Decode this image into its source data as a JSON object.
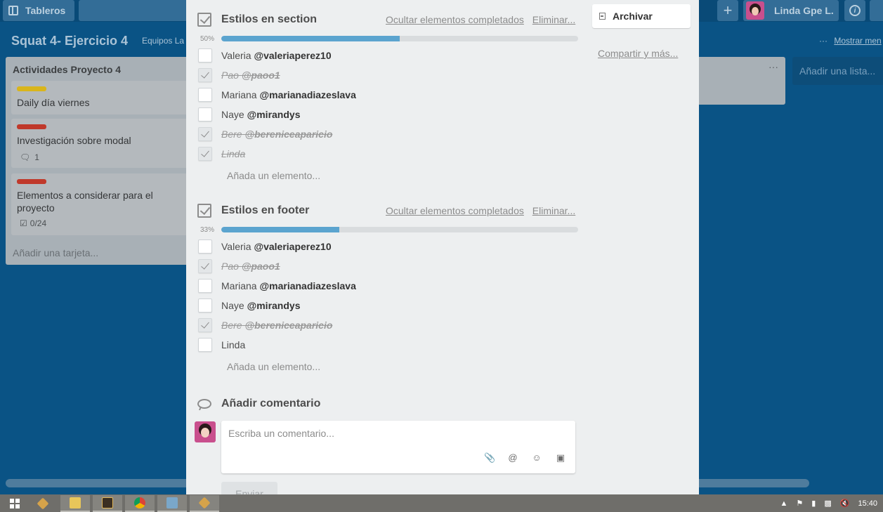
{
  "topbar": {
    "boards_label": "Tableros",
    "plus_label": "+",
    "user_name": "Linda Gpe L.",
    "info_label": "i"
  },
  "board": {
    "title": "Squat 4- Ejercicio 4",
    "team": "Equipos La",
    "show_menu_dots": "···",
    "show_menu": "Mostrar men",
    "list": {
      "title": "Actividades Proyecto 4",
      "cards": [
        {
          "label_color": "#d9b51c",
          "text": "Daily día viernes"
        },
        {
          "label_color": "#c0392b",
          "text": "Investigación sobre modal",
          "comments": "1"
        },
        {
          "label_color": "#c0392b",
          "text": "Elementos a considerar para el proyecto",
          "checklist": "0/24"
        }
      ],
      "add_card": "Añadir una tarjeta..."
    },
    "list2_dots": "···",
    "add_list": "Añadir una lista..."
  },
  "modal": {
    "archive_label": "Archivar",
    "share_label": "Compartir y más...",
    "checklists": [
      {
        "title": "Estilos en section",
        "hide_completed": "Ocultar elementos completados",
        "delete": "Eliminar...",
        "percent_label": "50%",
        "progress": 0.5,
        "items": [
          {
            "name": "Valeria",
            "handle": "@valeriaperez10",
            "done": false
          },
          {
            "name": "Pao",
            "handle": "@paoo1",
            "done": true
          },
          {
            "name": "Mariana",
            "handle": "@marianadiazeslava",
            "done": false
          },
          {
            "name": "Naye",
            "handle": "@mirandys",
            "done": false
          },
          {
            "name": "Bere",
            "handle": "@bereniceaparicio",
            "done": true
          },
          {
            "name": "Linda",
            "handle": "",
            "done": true
          }
        ],
        "add_item": "Añada un elemento..."
      },
      {
        "title": "Estilos en footer",
        "hide_completed": "Ocultar elementos completados",
        "delete": "Eliminar...",
        "percent_label": "33%",
        "progress": 0.33,
        "items": [
          {
            "name": "Valeria",
            "handle": "@valeriaperez10",
            "done": false
          },
          {
            "name": "Pao",
            "handle": "@paoo1",
            "done": true
          },
          {
            "name": "Mariana",
            "handle": "@marianadiazeslava",
            "done": false
          },
          {
            "name": "Naye",
            "handle": "@mirandys",
            "done": false
          },
          {
            "name": "Bere",
            "handle": "@bereniceaparicio",
            "done": true
          },
          {
            "name": "Linda",
            "handle": "",
            "done": false
          }
        ],
        "add_item": "Añada un elemento..."
      }
    ],
    "comment": {
      "title": "Añadir comentario",
      "placeholder": "Escriba un comentario...",
      "send_label": "Enviar"
    }
  },
  "taskbar": {
    "clock": "15:40"
  }
}
